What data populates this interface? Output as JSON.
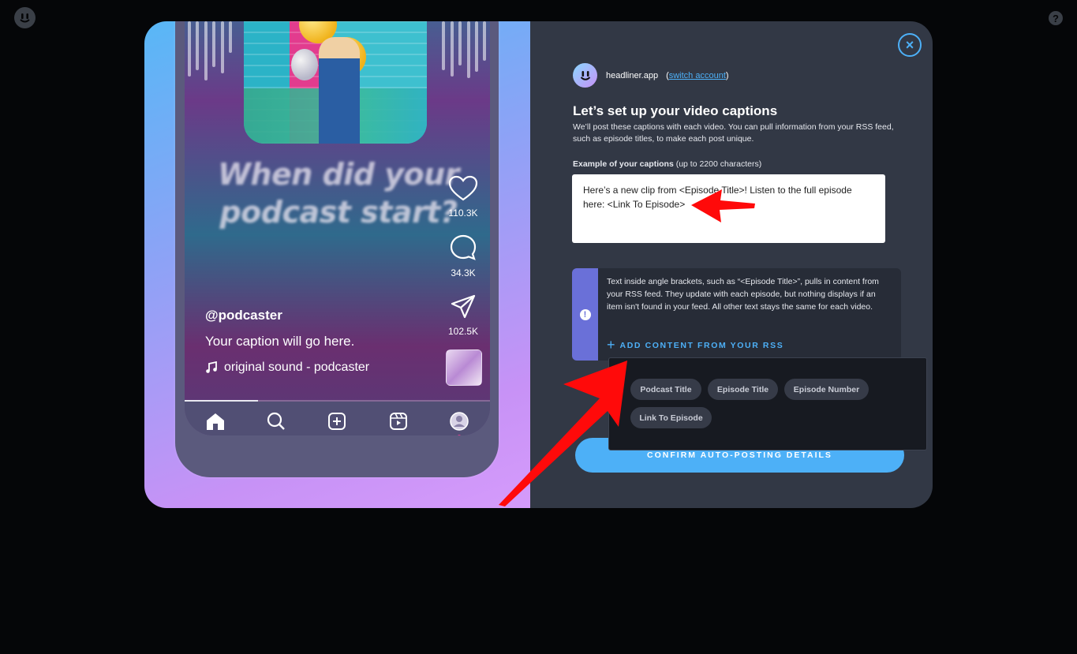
{
  "phone": {
    "big_text_line1": "When did your",
    "big_text_line2": "podcast start?",
    "likes": "110.3K",
    "comments": "34.3K",
    "shares": "102.5K",
    "handle": "@podcaster",
    "caption": "Your caption will go here.",
    "sound": "original sound - podcaster",
    "nav": [
      "home-icon",
      "search-icon",
      "add-icon",
      "reels-icon",
      "profile-icon"
    ],
    "progress_fraction": 0.24
  },
  "account": {
    "name": "headliner.app",
    "switch_open": "(",
    "switch_label": "switch account",
    "switch_close": ")"
  },
  "setup": {
    "title": "Let’s set up your video captions",
    "subtitle": "We’ll post these captions with each video. You can pull information from your RSS feed, such as episode titles, to make each post unique.",
    "example_label_bold": "Example of your captions",
    "example_label_rest": " (up to 2200 characters)",
    "caption_value": "Here’s a new clip from <Episode Title>! Listen to the full episode here: <Link To Episode>",
    "info_text": "Text inside angle brackets, such as “<Episode Title>”, pulls in content from your RSS feed. They update with each episode, but nothing displays if an item isn't found in your feed. All other text stays the same for each video.",
    "add_rss_label": "ADD CONTENT FROM YOUR RSS",
    "confirm_label": "CONFIRM AUTO-POSTING DETAILS"
  },
  "rss_options": [
    "Podcast Title",
    "Episode Title",
    "Episode Number",
    "Link To Episode"
  ],
  "colors": {
    "accent": "#4db0f7",
    "info_stripe": "#6a70d8",
    "annotation_arrow": "#ff0a0a",
    "panel": "#323845",
    "background": "#050608"
  }
}
